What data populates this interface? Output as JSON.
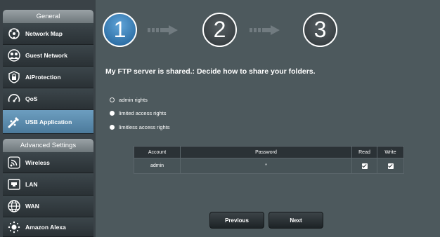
{
  "sidebar": {
    "general_header": "General",
    "general_items": [
      {
        "label": "Network Map"
      },
      {
        "label": "Guest Network"
      },
      {
        "label": "AiProtection"
      },
      {
        "label": "QoS"
      },
      {
        "label": "USB Application"
      }
    ],
    "advanced_header": "Advanced Settings",
    "advanced_items": [
      {
        "label": "Wireless"
      },
      {
        "label": "LAN"
      },
      {
        "label": "WAN"
      },
      {
        "label": "Amazon Alexa"
      }
    ]
  },
  "wizard": {
    "steps": [
      "1",
      "2",
      "3"
    ],
    "current_step": 1
  },
  "headline": "My FTP server is shared.: Decide how to share your folders.",
  "options": {
    "admin": "admin rights",
    "limited": "limited access rights",
    "limitless": "limitless access rights",
    "selected": "admin rights"
  },
  "table": {
    "headers": [
      "Account",
      "Password",
      "Read",
      "Write"
    ],
    "rows": [
      {
        "account": "admin",
        "password": "*",
        "read": true,
        "write": true
      }
    ]
  },
  "buttons": {
    "previous": "Previous",
    "next": "Next"
  },
  "colors": {
    "sidebar_bg": "#3a4247",
    "main_bg": "#4d595d",
    "active_accent": "#5b8db3",
    "table_header_bg": "#2b3236"
  }
}
